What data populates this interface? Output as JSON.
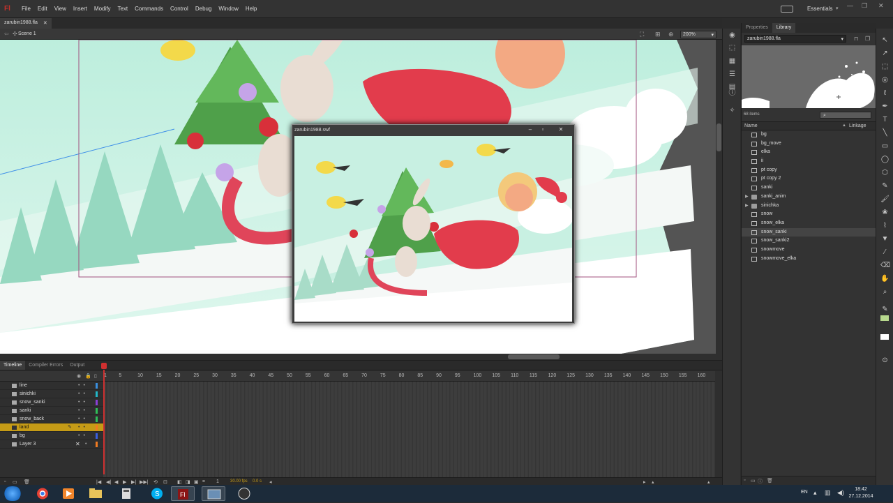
{
  "app": {
    "logo": "Fl",
    "menu": [
      "File",
      "Edit",
      "View",
      "Insert",
      "Modify",
      "Text",
      "Commands",
      "Control",
      "Debug",
      "Window",
      "Help"
    ],
    "workspace": "Essentials",
    "window_controls": [
      "—",
      "❐",
      "✕"
    ]
  },
  "document": {
    "tab_label": "zarubin1988.fla",
    "tab_close": "✕",
    "scene": "Scene 1",
    "zoom": "200%"
  },
  "panel": {
    "tabs": [
      "Properties",
      "Library"
    ],
    "active_tab": "Library",
    "library_selector": "zarubin1988.fla",
    "item_count": "68 items",
    "search_placeholder": "",
    "col_name": "Name",
    "col_linkage": "Linkage",
    "items": [
      {
        "name": "bg",
        "type": "symbol"
      },
      {
        "name": "bg_move",
        "type": "symbol"
      },
      {
        "name": "elka",
        "type": "symbol"
      },
      {
        "name": "ii",
        "type": "symbol"
      },
      {
        "name": "pt copy",
        "type": "symbol"
      },
      {
        "name": "pt copy 2",
        "type": "symbol"
      },
      {
        "name": "sanki",
        "type": "symbol"
      },
      {
        "name": "sanki_anim",
        "type": "folder"
      },
      {
        "name": "sinichka",
        "type": "folder"
      },
      {
        "name": "snow",
        "type": "symbol"
      },
      {
        "name": "snow_elka",
        "type": "symbol"
      },
      {
        "name": "snow_sanki",
        "type": "symbol"
      },
      {
        "name": "snow_sanki2",
        "type": "symbol"
      },
      {
        "name": "snowmove",
        "type": "symbol"
      },
      {
        "name": "snowmove_elka",
        "type": "symbol"
      }
    ],
    "selected_item": "snow_sanki"
  },
  "timeline": {
    "tabs": [
      "Timeline",
      "Compiler Errors",
      "Output"
    ],
    "active_tab": "Timeline",
    "ticks": [
      "1",
      "5",
      "10",
      "15",
      "20",
      "25",
      "30",
      "35",
      "40",
      "45",
      "50",
      "55",
      "60",
      "65",
      "70",
      "75",
      "80",
      "85",
      "90",
      "95",
      "100",
      "105",
      "110",
      "115",
      "120",
      "125",
      "130",
      "135",
      "140",
      "145",
      "150",
      "155",
      "160"
    ],
    "layers": [
      {
        "name": "line",
        "color": "#3a8fe0"
      },
      {
        "name": "sinichki",
        "color": "#22b7c9"
      },
      {
        "name": "snow_sanki",
        "color": "#8a3fd6"
      },
      {
        "name": "sanki",
        "color": "#2fbf58"
      },
      {
        "name": "snow_back",
        "color": "#2fbf58"
      },
      {
        "name": "land",
        "color": "#f07b22"
      },
      {
        "name": "bg",
        "color": "#3a5fe0"
      },
      {
        "name": "Layer 3",
        "color": "#f07b22"
      }
    ],
    "active_layer": "land",
    "fps": "30.00 fps",
    "time": "0.0 s",
    "current_frame": "1"
  },
  "swf_window": {
    "title": "zarubin1988.swf"
  },
  "taskbar": {
    "lang": "EN",
    "time": "18:42",
    "date": "27.12.2014"
  },
  "colors": {
    "accent_layer": "#c59b16",
    "playhead": "#d03030",
    "flash_logo": "#c8312a"
  }
}
